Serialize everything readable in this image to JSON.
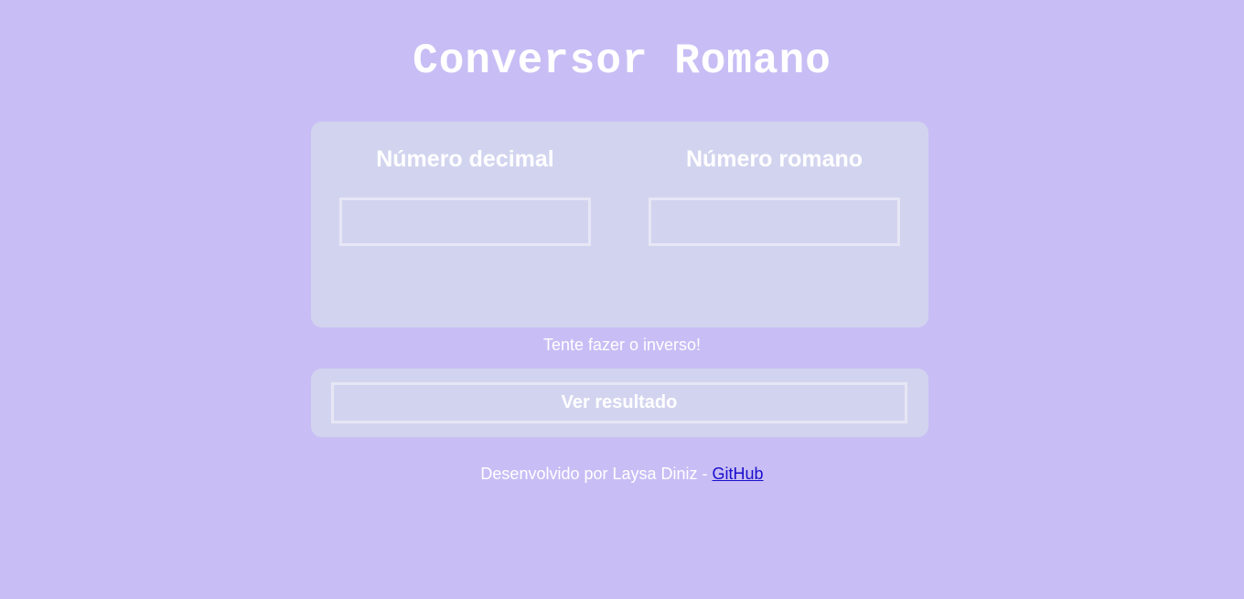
{
  "header": {
    "title": "Conversor Romano"
  },
  "converter": {
    "decimal_label": "Número decimal",
    "decimal_value": "",
    "roman_label": "Número romano",
    "roman_value": ""
  },
  "hint": "Tente fazer o inverso!",
  "actions": {
    "result_label": "Ver resultado"
  },
  "footer": {
    "credit_text": "Desenvolvido por Laysa Diniz - ",
    "link_label": "GitHub"
  },
  "colors": {
    "background": "#c8bef5",
    "card": "#d2d4ef",
    "text": "#ffffff",
    "link": "#1a0dcc"
  }
}
